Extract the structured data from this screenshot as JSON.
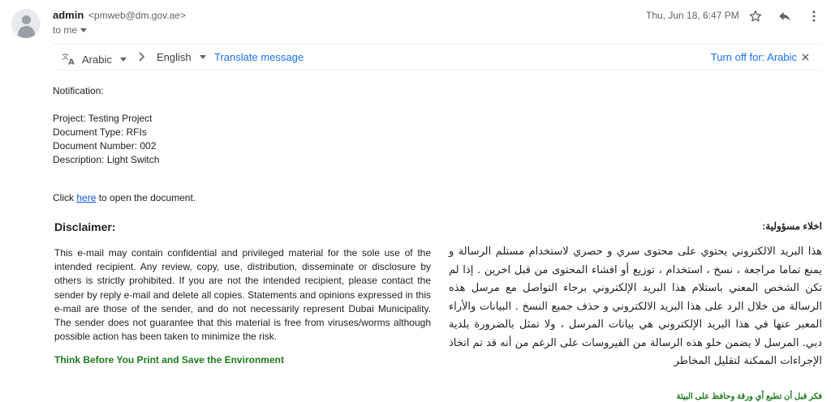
{
  "header": {
    "sender_name": "admin",
    "sender_email": "<pmweb@dm.gov.ae>",
    "to_label": "to me",
    "date": "Thu, Jun 18, 6:47 PM"
  },
  "translate_bar": {
    "from_lang": "Arabic",
    "to_lang": "English",
    "translate_link": "Translate message",
    "turn_off": "Turn off for: Arabic"
  },
  "body": {
    "notification": "Notification:",
    "project": "Project: Testing Project",
    "doc_type": "Document Type: RFIs",
    "doc_number": "Document Number: 002",
    "description": "Description: Light Switch",
    "click_prefix": "Click ",
    "click_link": "here",
    "click_suffix": " to open the document."
  },
  "disclaimer": {
    "title": "Disclaimer:",
    "text": "This e-mail may contain confidential and privileged material for the sole use of the intended recipient. Any review, copy, use, distribution, disseminate or disclosure by others is strictly prohibited. If you are not the intended recipient, please contact the sender by reply e-mail and delete all copies. Statements and opinions expressed in this e-mail are those of the sender, and do not necessarily represent Dubai Municipality. The sender does not guarantee that this material is free from viruses/worms although possible action has been taken to minimize the risk.",
    "think": "Think Before You Print and Save the Environment"
  },
  "arabic": {
    "title": "اخلاء مسؤولية:",
    "text": "هذا البريد الالكتروني يحتوي على محتوى سري و حصري لاستخدام مستلم الرسالة و يمنع تماما مراجعة ، نسخ ، استخدام ، توزيع أو افشاء المحتوى من قبل اخرين . إذا لم تكن الشخص المعني باستلام هذا البريد الإلكتروني برجاء التواصل مع مرسل هذه الرسالة من خلال الرد على هذا البريد الالكتروني و حذف جميع النسخ . البيانات والأراء المعبر عنها في هذا البريد الإلكتروني هي بيانات المرسل ، ولا تمثل بالضرورة بلدية دبي. المرسل لا يضمن خلو هذه الرسالة من الفيروسات على الرغم من أنه قد تم اتخاذ الإجراءات الممكنة لتقليل المخاطر",
    "think": "فكر قبل أن تطبع أي ورقة وحافظ على البيئة"
  },
  "icons": {
    "star": "star-icon",
    "reply": "reply-icon",
    "more": "more-vert-icon",
    "translate": "translate-icon",
    "close": "close-icon"
  }
}
